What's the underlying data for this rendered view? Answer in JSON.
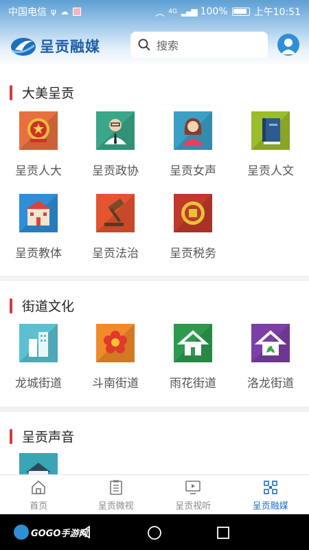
{
  "status_bar": {
    "carrier": "中国电信",
    "network": "4G",
    "battery": "100%",
    "time": "上午10:51"
  },
  "header": {
    "app_name": "呈贡融媒",
    "search_placeholder": "搜索"
  },
  "sections": [
    {
      "title": "大美呈贡",
      "items": [
        {
          "label": "呈贡人大",
          "icon": "national-emblem-icon",
          "color": "#e8703f"
        },
        {
          "label": "呈贡政协",
          "icon": "official-person-icon",
          "color": "#3aa68a"
        },
        {
          "label": "呈贡女声",
          "icon": "woman-icon",
          "color": "#3c9fc4"
        },
        {
          "label": "呈贡人文",
          "icon": "book-icon",
          "color": "#9bbc2c"
        },
        {
          "label": "呈贡教体",
          "icon": "school-building-icon",
          "color": "#2e8ed8"
        },
        {
          "label": "呈贡法治",
          "icon": "gavel-icon",
          "color": "#e3542f"
        },
        {
          "label": "呈贡税务",
          "icon": "tax-emblem-icon",
          "color": "#c0392b"
        }
      ]
    },
    {
      "title": "街道文化",
      "items": [
        {
          "label": "龙城街道",
          "icon": "buildings-icon",
          "color": "#5bc0d0"
        },
        {
          "label": "斗南街道",
          "icon": "flower-icon",
          "color": "#f08a2a"
        },
        {
          "label": "雨花街道",
          "icon": "house-icon",
          "color": "#2e9a4f"
        },
        {
          "label": "洛龙街道",
          "icon": "leaf-house-icon",
          "color": "#7b3fa6"
        }
      ]
    },
    {
      "title": "呈贡声音",
      "items": [
        {
          "label": "",
          "icon": "house-icon",
          "color": "#3aa6b5"
        }
      ]
    }
  ],
  "bottom_nav": [
    {
      "label": "首页",
      "icon": "home-icon",
      "active": false
    },
    {
      "label": "呈贡微视",
      "icon": "clipboard-icon",
      "active": false
    },
    {
      "label": "呈贡视听",
      "icon": "screen-play-icon",
      "active": false
    },
    {
      "label": "呈贡融媒",
      "icon": "grid-nodes-icon",
      "active": true
    }
  ],
  "watermark": {
    "text": "GOGO手游网"
  },
  "colors": {
    "accent": "#1f6fbf",
    "section_marker": "#d9373c"
  }
}
